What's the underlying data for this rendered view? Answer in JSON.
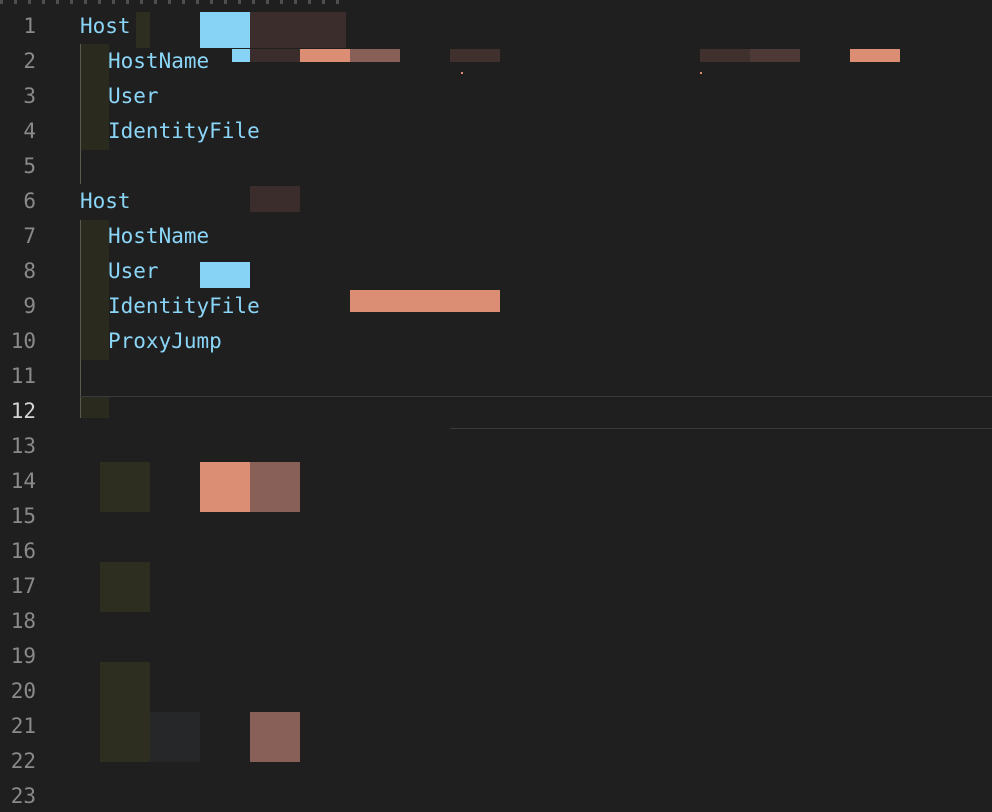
{
  "editor": {
    "lines": [
      {
        "n": "1",
        "text": "Host"
      },
      {
        "n": "2",
        "text": "HostName"
      },
      {
        "n": "3",
        "text": "User"
      },
      {
        "n": "4",
        "text": "IdentityFile"
      },
      {
        "n": "5",
        "text": ""
      },
      {
        "n": "6",
        "text": "Host"
      },
      {
        "n": "7",
        "text": "HostName"
      },
      {
        "n": "8",
        "text": "User"
      },
      {
        "n": "9",
        "text": "IdentityFile"
      },
      {
        "n": "10",
        "text": "ProxyJump"
      },
      {
        "n": "11",
        "text": ""
      },
      {
        "n": "12",
        "text": ""
      },
      {
        "n": "13",
        "text": ""
      },
      {
        "n": "14",
        "text": ""
      },
      {
        "n": "15",
        "text": ""
      },
      {
        "n": "16",
        "text": ""
      },
      {
        "n": "17",
        "text": ""
      },
      {
        "n": "18",
        "text": ""
      },
      {
        "n": "19",
        "text": ""
      },
      {
        "n": "20",
        "text": ""
      },
      {
        "n": "21",
        "text": ""
      },
      {
        "n": "22",
        "text": ""
      },
      {
        "n": "23",
        "text": ""
      }
    ],
    "active_line": "12",
    "colors": {
      "keyword": "#8bd5f7",
      "line_number": "#8a8a8a",
      "background": "#1f1f1f"
    }
  }
}
